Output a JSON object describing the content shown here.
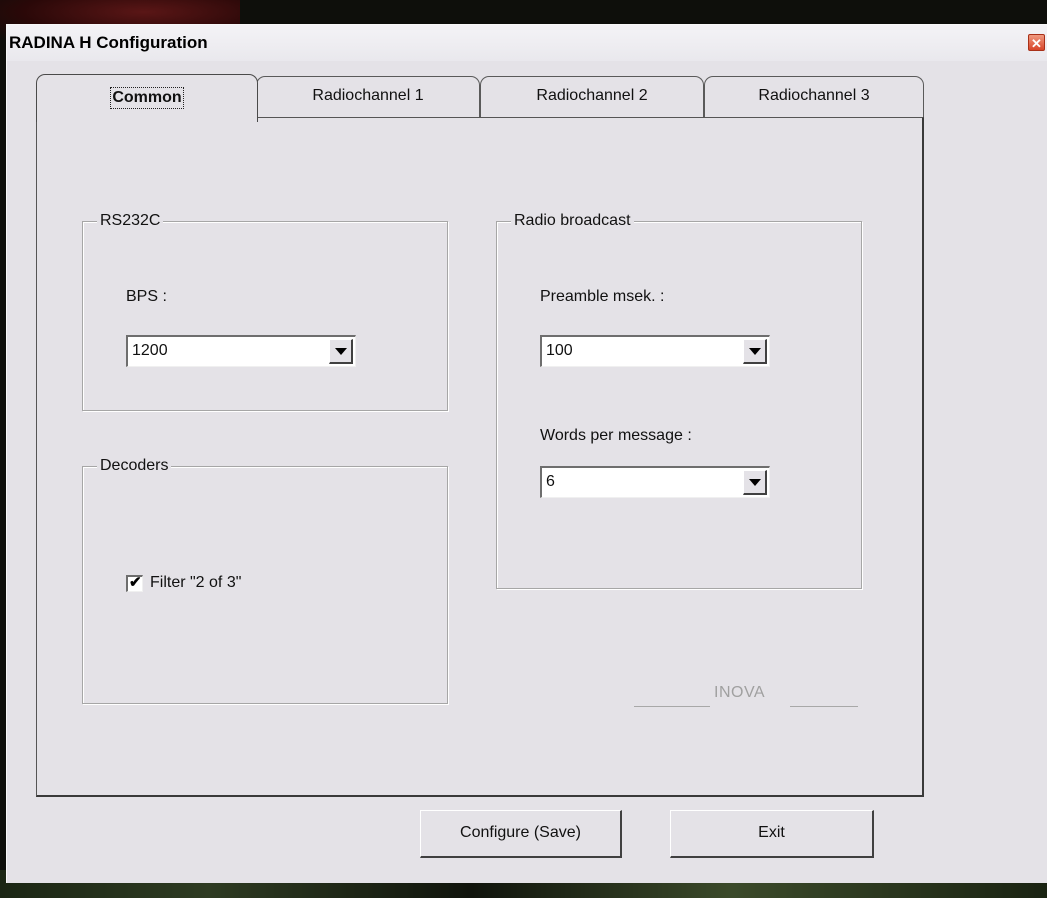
{
  "window": {
    "title": "RADINA H Configuration",
    "close_glyph": "✕"
  },
  "tabs": [
    {
      "label": "Common",
      "active": true
    },
    {
      "label": "Radiochannel 1",
      "active": false
    },
    {
      "label": "Radiochannel 2",
      "active": false
    },
    {
      "label": "Radiochannel 3",
      "active": false
    }
  ],
  "rs232c": {
    "title": "RS232C",
    "bps_label": "BPS :",
    "bps_value": "1200"
  },
  "decoders": {
    "title": "Decoders",
    "filter_label": "Filter \"2 of 3\"",
    "filter_checked": true,
    "check_glyph": "✔"
  },
  "radio_broadcast": {
    "title": "Radio broadcast",
    "preamble_label": "Preamble msek. :",
    "preamble_value": "100",
    "words_label": "Words per message :",
    "words_value": "6"
  },
  "footer": {
    "brand": "INOVA"
  },
  "buttons": {
    "configure_label": "Configure (Save)",
    "exit_label": "Exit"
  },
  "icons": {
    "close": "close-icon",
    "dropdown": "chevron-down-icon",
    "check": "check-icon"
  },
  "colors": {
    "window_bg": "#e4e2e7",
    "close_button": "#d8452a",
    "brand_text": "#a0a0a0"
  }
}
